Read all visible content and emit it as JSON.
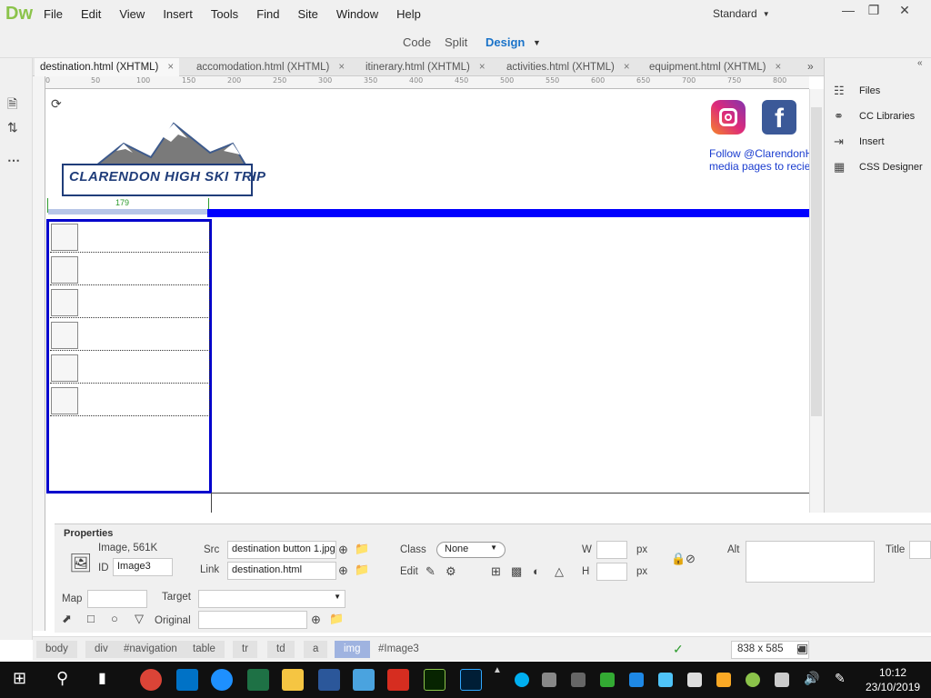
{
  "app": {
    "logo": "Dw"
  },
  "menu": [
    "File",
    "Edit",
    "View",
    "Insert",
    "Tools",
    "Find",
    "Site",
    "Window",
    "Help"
  ],
  "workspace": "Standard",
  "view_modes": {
    "code": "Code",
    "split": "Split",
    "design": "Design"
  },
  "tabs": [
    {
      "label": "destination.html (XHTML)",
      "active": true
    },
    {
      "label": "accomodation.html (XHTML)"
    },
    {
      "label": "itinerary.html (XHTML)"
    },
    {
      "label": "activities.html (XHTML)"
    },
    {
      "label": "equipment.html (XHTML)"
    }
  ],
  "ruler_ticks": [
    "0",
    "50",
    "100",
    "150",
    "200",
    "250",
    "300",
    "350",
    "400",
    "450",
    "500",
    "550",
    "600",
    "650",
    "700",
    "750",
    "800"
  ],
  "page": {
    "banner_text": "CLARENDON HIGH SKI TRIP",
    "column_width": "179",
    "follow_line1": "Follow @ClarendonHi",
    "follow_line2": "media pages to reciev"
  },
  "right_panel": [
    "Files",
    "CC Libraries",
    "Insert",
    "CSS Designer"
  ],
  "properties": {
    "title": "Properties",
    "summary": "Image, 561K",
    "id_label": "ID",
    "id_value": "Image3",
    "src_label": "Src",
    "src_value": "destination button 1.jpg",
    "link_label": "Link",
    "link_value": "destination.html",
    "class_label": "Class",
    "class_value": "None",
    "edit_label": "Edit",
    "w_label": "W",
    "h_label": "H",
    "unit": "px",
    "alt_label": "Alt",
    "title_label": "Title",
    "map_label": "Map",
    "target_label": "Target",
    "original_label": "Original"
  },
  "tag_path": [
    "body",
    "div",
    "#navigation",
    "table",
    "tr",
    "td",
    "a",
    "img",
    "#Image3"
  ],
  "dimensions": "838 x 585",
  "clock": {
    "time": "10:12",
    "date": "23/10/2019"
  }
}
